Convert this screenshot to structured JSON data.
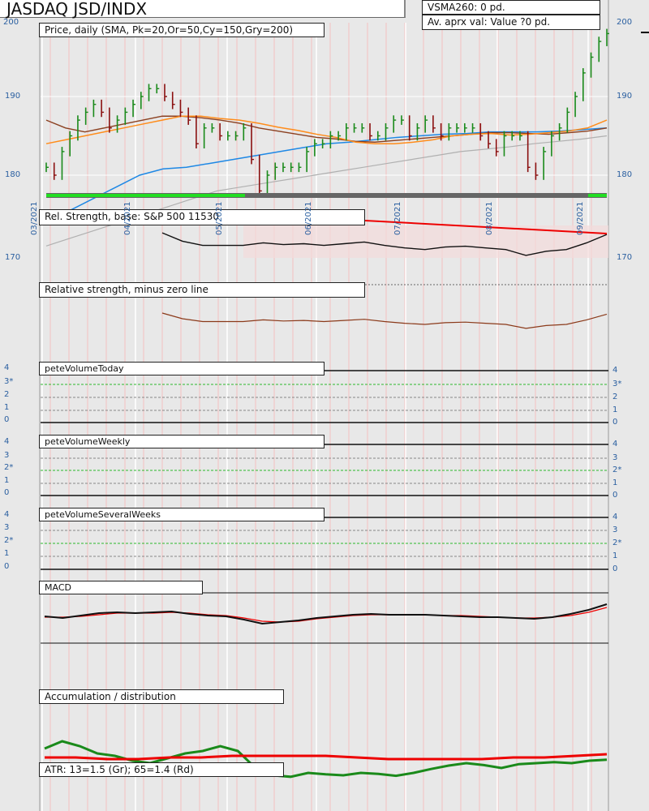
{
  "header": {
    "title": "JASDAQ JSD/INDX",
    "vsma": "VSMA260: 0 pd.",
    "avg": "Av. aprx val: Value ?0 pd."
  },
  "panels": {
    "price": "Price, daily (SMA, Pk=20,Or=50,Cy=150,Gry=200)",
    "rs": "Rel. Strength, base: S&P 500 11530",
    "rs_zero": "Relative strength, minus zero line",
    "vol_today": "peteVolumeToday",
    "vol_weekly": "peteVolumeWeekly",
    "vol_several": "peteVolumeSeveralWeeks",
    "macd": "MACD",
    "accum": "Accumulation / distribution",
    "atr": "ATR: 13=1.5 (Gr); 65=1.4 (Rd)"
  },
  "axes": {
    "price_ticks": [
      "200",
      "190",
      "180",
      "170"
    ],
    "months": [
      "03/2021",
      "04/2021",
      "05/2021",
      "06/2021",
      "07/2021",
      "08/2021",
      "09/2021"
    ],
    "vol_today_ticks": [
      "4",
      "3*",
      "2",
      "1",
      "0"
    ],
    "vol_weekly_ticks": [
      "4",
      "3",
      "2*",
      "1",
      "0"
    ],
    "vol_several_ticks": [
      "4",
      "3",
      "2*",
      "1",
      "0"
    ]
  },
  "colors": {
    "up": "#1a8a1a",
    "down": "#8b1010",
    "sma20": "#f0a0a0",
    "sma50": "#ff8c1a",
    "sma150": "#8b4020",
    "sma200": "#b0b0b0",
    "blue": "#1e88e5"
  },
  "chart_data": {
    "type": "line",
    "title": "JASDAQ JSD/INDX",
    "ylim": [
      177,
      200
    ],
    "price_close": [
      181,
      180,
      183,
      185,
      187,
      188,
      189,
      188,
      186,
      187,
      188,
      189,
      190,
      191,
      191,
      190,
      189,
      188,
      187,
      184,
      186,
      186,
      185,
      185,
      185,
      186,
      182,
      178,
      180,
      181,
      181,
      181,
      181,
      183,
      184,
      184,
      185,
      185,
      186,
      186,
      186,
      185,
      185,
      186,
      187,
      187,
      185,
      186,
      187,
      186,
      185,
      186,
      186,
      186,
      186,
      185,
      184,
      183,
      185,
      185,
      185,
      181,
      180,
      183,
      185,
      186,
      188,
      190,
      193,
      195,
      197,
      198
    ],
    "sma50": [
      184,
      184.5,
      185,
      185.5,
      186,
      186.5,
      187,
      187.5,
      187.5,
      187.2,
      187,
      186.6,
      186.1,
      185.7,
      185.2,
      184.8,
      184.2,
      184,
      184,
      184.2,
      184.5,
      185,
      185.2,
      185.3,
      185.1,
      185.2,
      185.4,
      185.6,
      186,
      187
    ],
    "sma150": [
      187,
      186,
      185.5,
      186,
      186.5,
      187,
      187.5,
      187.5,
      187.3,
      187,
      186.6,
      186,
      185.6,
      185.2,
      184.8,
      184.6,
      184.3,
      184.2,
      184.4,
      184.6,
      184.8,
      185,
      185.2,
      185.4,
      185.4,
      185.3,
      185.2,
      185.4,
      185.6,
      186
    ],
    "sma_blue": [
      174,
      175.5,
      177,
      178.5,
      180,
      180.8,
      181,
      181.5,
      182,
      182.5,
      183,
      183.5,
      184,
      184.2,
      184.5,
      184.8,
      185,
      185.2,
      185.3,
      185.5,
      185.5,
      185.5,
      185.6,
      185.8,
      186
    ],
    "sma200": [
      171,
      172,
      173,
      174,
      175,
      176,
      177,
      178,
      178.5,
      179,
      179.5,
      180,
      180.5,
      181,
      181.5,
      182,
      182.5,
      183,
      183.3,
      183.6,
      184,
      184.3,
      184.6,
      185
    ],
    "macd": [
      0.5,
      0.3,
      0.6,
      0.9,
      1.0,
      0.9,
      1.0,
      1.1,
      0.8,
      0.6,
      0.5,
      0.1,
      -0.4,
      -0.2,
      0.0,
      0.3,
      0.5,
      0.7,
      0.8,
      0.7,
      0.7,
      0.7,
      0.6,
      0.5,
      0.4,
      0.4,
      0.3,
      0.2,
      0.4,
      0.8,
      1.3,
      2.0
    ],
    "macd_signal": [
      0.4,
      0.4,
      0.5,
      0.7,
      0.9,
      0.9,
      0.9,
      1.0,
      0.9,
      0.7,
      0.6,
      0.3,
      -0.1,
      -0.2,
      -0.1,
      0.2,
      0.4,
      0.6,
      0.7,
      0.7,
      0.7,
      0.7,
      0.6,
      0.6,
      0.5,
      0.4,
      0.3,
      0.3,
      0.4,
      0.6,
      1.0,
      1.6
    ],
    "accum": [
      2,
      3.5,
      2.5,
      1,
      0.5,
      -0.5,
      -1,
      0,
      1,
      1.5,
      2.5,
      1.5,
      -2,
      -3.5,
      -3.8,
      -3,
      -3.3,
      -3.5,
      -3,
      -3.2,
      -3.6,
      -3,
      -2.2,
      -1.5,
      -1,
      -1.4,
      -2,
      -1.2,
      -1,
      -0.8,
      -1,
      -0.5,
      -0.3
    ],
    "atr13": [
      1.3,
      1.3,
      1.2,
      1.2,
      1.3,
      1.3,
      1.4,
      1.4,
      1.4,
      1.4,
      1.3,
      1.2,
      1.2,
      1.2,
      1.2,
      1.3,
      1.3,
      1.4,
      1.5
    ],
    "rs": [
      173,
      172,
      171.5,
      171.5,
      171.5,
      171.8,
      171.6,
      171.7,
      171.5,
      171.7,
      171.9,
      171.5,
      171.2,
      171,
      171.3,
      171.4,
      171.2,
      171,
      170.3,
      170.8,
      171,
      171.8,
      172.8
    ]
  }
}
